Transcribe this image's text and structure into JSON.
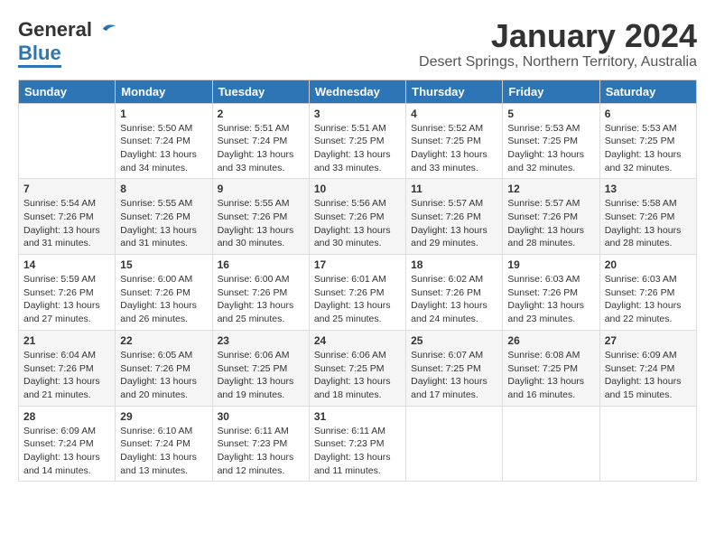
{
  "header": {
    "logo_general": "General",
    "logo_blue": "Blue",
    "month_title": "January 2024",
    "subtitle": "Desert Springs, Northern Territory, Australia"
  },
  "weekdays": [
    "Sunday",
    "Monday",
    "Tuesday",
    "Wednesday",
    "Thursday",
    "Friday",
    "Saturday"
  ],
  "weeks": [
    [
      {
        "day": "",
        "info": ""
      },
      {
        "day": "1",
        "info": "Sunrise: 5:50 AM\nSunset: 7:24 PM\nDaylight: 13 hours\nand 34 minutes."
      },
      {
        "day": "2",
        "info": "Sunrise: 5:51 AM\nSunset: 7:24 PM\nDaylight: 13 hours\nand 33 minutes."
      },
      {
        "day": "3",
        "info": "Sunrise: 5:51 AM\nSunset: 7:25 PM\nDaylight: 13 hours\nand 33 minutes."
      },
      {
        "day": "4",
        "info": "Sunrise: 5:52 AM\nSunset: 7:25 PM\nDaylight: 13 hours\nand 33 minutes."
      },
      {
        "day": "5",
        "info": "Sunrise: 5:53 AM\nSunset: 7:25 PM\nDaylight: 13 hours\nand 32 minutes."
      },
      {
        "day": "6",
        "info": "Sunrise: 5:53 AM\nSunset: 7:25 PM\nDaylight: 13 hours\nand 32 minutes."
      }
    ],
    [
      {
        "day": "7",
        "info": "Sunrise: 5:54 AM\nSunset: 7:26 PM\nDaylight: 13 hours\nand 31 minutes."
      },
      {
        "day": "8",
        "info": "Sunrise: 5:55 AM\nSunset: 7:26 PM\nDaylight: 13 hours\nand 31 minutes."
      },
      {
        "day": "9",
        "info": "Sunrise: 5:55 AM\nSunset: 7:26 PM\nDaylight: 13 hours\nand 30 minutes."
      },
      {
        "day": "10",
        "info": "Sunrise: 5:56 AM\nSunset: 7:26 PM\nDaylight: 13 hours\nand 30 minutes."
      },
      {
        "day": "11",
        "info": "Sunrise: 5:57 AM\nSunset: 7:26 PM\nDaylight: 13 hours\nand 29 minutes."
      },
      {
        "day": "12",
        "info": "Sunrise: 5:57 AM\nSunset: 7:26 PM\nDaylight: 13 hours\nand 28 minutes."
      },
      {
        "day": "13",
        "info": "Sunrise: 5:58 AM\nSunset: 7:26 PM\nDaylight: 13 hours\nand 28 minutes."
      }
    ],
    [
      {
        "day": "14",
        "info": "Sunrise: 5:59 AM\nSunset: 7:26 PM\nDaylight: 13 hours\nand 27 minutes."
      },
      {
        "day": "15",
        "info": "Sunrise: 6:00 AM\nSunset: 7:26 PM\nDaylight: 13 hours\nand 26 minutes."
      },
      {
        "day": "16",
        "info": "Sunrise: 6:00 AM\nSunset: 7:26 PM\nDaylight: 13 hours\nand 25 minutes."
      },
      {
        "day": "17",
        "info": "Sunrise: 6:01 AM\nSunset: 7:26 PM\nDaylight: 13 hours\nand 25 minutes."
      },
      {
        "day": "18",
        "info": "Sunrise: 6:02 AM\nSunset: 7:26 PM\nDaylight: 13 hours\nand 24 minutes."
      },
      {
        "day": "19",
        "info": "Sunrise: 6:03 AM\nSunset: 7:26 PM\nDaylight: 13 hours\nand 23 minutes."
      },
      {
        "day": "20",
        "info": "Sunrise: 6:03 AM\nSunset: 7:26 PM\nDaylight: 13 hours\nand 22 minutes."
      }
    ],
    [
      {
        "day": "21",
        "info": "Sunrise: 6:04 AM\nSunset: 7:26 PM\nDaylight: 13 hours\nand 21 minutes."
      },
      {
        "day": "22",
        "info": "Sunrise: 6:05 AM\nSunset: 7:26 PM\nDaylight: 13 hours\nand 20 minutes."
      },
      {
        "day": "23",
        "info": "Sunrise: 6:06 AM\nSunset: 7:25 PM\nDaylight: 13 hours\nand 19 minutes."
      },
      {
        "day": "24",
        "info": "Sunrise: 6:06 AM\nSunset: 7:25 PM\nDaylight: 13 hours\nand 18 minutes."
      },
      {
        "day": "25",
        "info": "Sunrise: 6:07 AM\nSunset: 7:25 PM\nDaylight: 13 hours\nand 17 minutes."
      },
      {
        "day": "26",
        "info": "Sunrise: 6:08 AM\nSunset: 7:25 PM\nDaylight: 13 hours\nand 16 minutes."
      },
      {
        "day": "27",
        "info": "Sunrise: 6:09 AM\nSunset: 7:24 PM\nDaylight: 13 hours\nand 15 minutes."
      }
    ],
    [
      {
        "day": "28",
        "info": "Sunrise: 6:09 AM\nSunset: 7:24 PM\nDaylight: 13 hours\nand 14 minutes."
      },
      {
        "day": "29",
        "info": "Sunrise: 6:10 AM\nSunset: 7:24 PM\nDaylight: 13 hours\nand 13 minutes."
      },
      {
        "day": "30",
        "info": "Sunrise: 6:11 AM\nSunset: 7:23 PM\nDaylight: 13 hours\nand 12 minutes."
      },
      {
        "day": "31",
        "info": "Sunrise: 6:11 AM\nSunset: 7:23 PM\nDaylight: 13 hours\nand 11 minutes."
      },
      {
        "day": "",
        "info": ""
      },
      {
        "day": "",
        "info": ""
      },
      {
        "day": "",
        "info": ""
      }
    ]
  ]
}
